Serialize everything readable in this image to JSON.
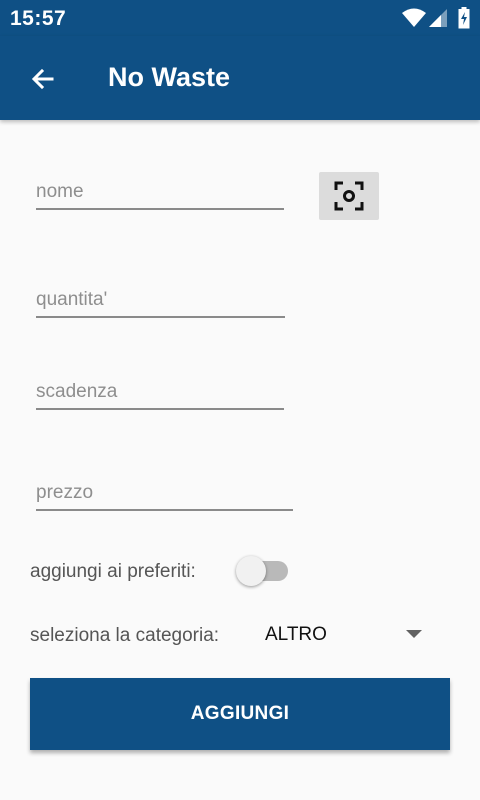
{
  "status_bar": {
    "time": "15:57",
    "icons": [
      "wifi-icon",
      "signal-icon",
      "battery-charging-icon"
    ]
  },
  "app_bar": {
    "title": "No Waste",
    "back_icon": "arrow-back-icon"
  },
  "form": {
    "name": {
      "value": "",
      "placeholder": "nome"
    },
    "scan_icon": "barcode-scan-icon",
    "quantity": {
      "value": "",
      "placeholder": "quantita'"
    },
    "expiry": {
      "value": "",
      "placeholder": "scadenza"
    },
    "price": {
      "value": "",
      "placeholder": "prezzo"
    },
    "favorites_label": "aggiungi ai preferiti:",
    "favorites_on": false,
    "category_label": "seleziona la categoria:",
    "category_selected": "ALTRO",
    "submit_label": "AGGIUNGI"
  },
  "colors": {
    "primary": "#0f5085",
    "background": "#fafafa"
  }
}
